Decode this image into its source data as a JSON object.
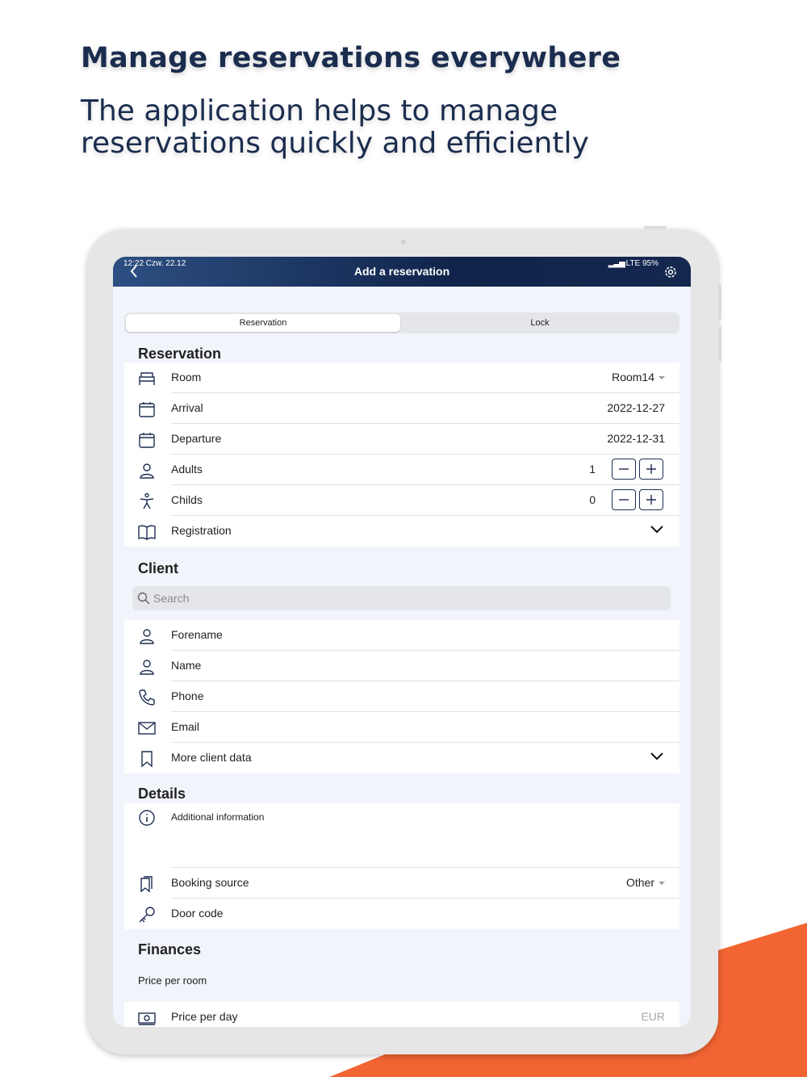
{
  "headline": "Manage reservations everywhere",
  "subline": "The application helps to manage reservations quickly and efficiently",
  "colors": {
    "accent_orange": "#f26432",
    "navy": "#1b2d4f"
  },
  "status": {
    "time": "12:22  Czw. 22.12",
    "right": "LTE 95%"
  },
  "nav": {
    "title": "Add a reservation",
    "back_icon": "chevron-left-icon",
    "settings_icon": "gear-icon"
  },
  "segments": {
    "reservation": "Reservation",
    "lock": "Lock"
  },
  "reservation": {
    "title": "Reservation",
    "room": {
      "label": "Room",
      "value": "Room14"
    },
    "arrival": {
      "label": "Arrival",
      "value": "2022-12-27"
    },
    "departure": {
      "label": "Departure",
      "value": "2022-12-31"
    },
    "adults": {
      "label": "Adults",
      "value": "1"
    },
    "childs": {
      "label": "Childs",
      "value": "0"
    },
    "registration": {
      "label": "Registration"
    }
  },
  "client": {
    "title": "Client",
    "search_placeholder": "Search",
    "forename": "Forename",
    "name": "Name",
    "phone": "Phone",
    "email": "Email",
    "more": "More client data"
  },
  "details": {
    "title": "Details",
    "additional": "Additional information",
    "booking_source": {
      "label": "Booking source",
      "value": "Other"
    },
    "door_code": "Door code"
  },
  "finances": {
    "title": "Finances",
    "price_per_room": "Price per room",
    "price_per_day": {
      "label": "Price per day",
      "currency": "EUR"
    }
  }
}
